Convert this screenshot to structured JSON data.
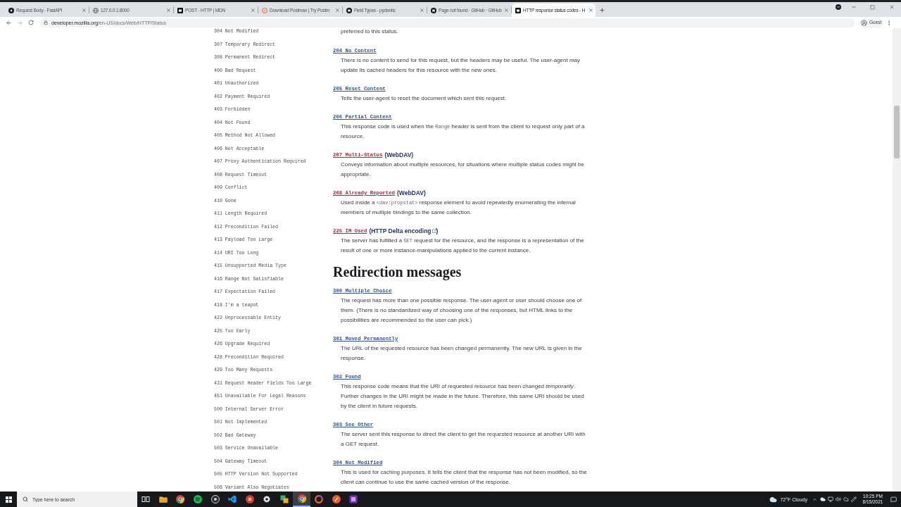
{
  "browser": {
    "tabs": [
      {
        "title": "Request Body - FastAPI",
        "kind": "bolt",
        "selected": false
      },
      {
        "title": "127.0.0.1:8000",
        "kind": "globe",
        "selected": false
      },
      {
        "title": "POST - HTTP | MDN",
        "kind": "square",
        "selected": false
      },
      {
        "title": "Download Postman | Try Postm",
        "kind": "ring",
        "selected": false
      },
      {
        "title": "Field Types - pydantic",
        "kind": "cat",
        "selected": false
      },
      {
        "title": "Page not found · GitHub · GitHub",
        "kind": "cat",
        "selected": false
      },
      {
        "title": "HTTP response status codes - H",
        "kind": "square",
        "selected": true
      }
    ],
    "url": {
      "host": "developer.mozilla.org",
      "path": "/en-US/docs/Web/HTTP/Status"
    },
    "profile": "Guest"
  },
  "sidebar": {
    "items": [
      "304 Not Modified",
      "307 Temporary Redirect",
      "308 Permanent Redirect",
      "400 Bad Request",
      "401 Unauthorized",
      "402 Payment Required",
      "403 Forbidden",
      "404 Not Found",
      "405 Method Not Allowed",
      "406 Not Acceptable",
      "407 Proxy Authentication Required",
      "408 Request Timeout",
      "409 Conflict",
      "410 Gone",
      "411 Length Required",
      "412 Precondition Failed",
      "413 Payload Too Large",
      "414 URI Too Long",
      "415 Unsupported Media Type",
      "416 Range Not Satisfiable",
      "417 Expectation Failed",
      "418 I'm a teapot",
      "422 Unprocessable Entity",
      "425 Too Early",
      "426 Upgrade Required",
      "428 Precondition Required",
      "429 Too Many Requests",
      "431 Request Header Fields Too Large",
      "451 Unavailable For Legal Reasons",
      "500 Internal Server Error",
      "501 Not Implemented",
      "502 Bad Gateway",
      "503 Service Unavailable",
      "504 Gateway Timeout",
      "505 HTTP Version Not Supported",
      "506 Variant Also Negotiates"
    ]
  },
  "content": {
    "lead": "preferred to this status.",
    "blocks": [
      {
        "kind": "entry",
        "term": "204 No Content",
        "color": "#34548c",
        "description": [
          {
            "kind": "text",
            "text": "There is no content to send for this request, but the headers may be useful. The user-agent may update its cached headers for this resource with the new ones."
          }
        ]
      },
      {
        "kind": "entry",
        "term": "205 Reset Content",
        "color": "#34548c",
        "description": [
          {
            "kind": "text",
            "text": "Tells the user-agent to reset the document which sent this request."
          }
        ]
      },
      {
        "kind": "entry",
        "term": "206 Partial Content",
        "color": "#34548c",
        "description": [
          {
            "kind": "text",
            "text": "This response code is used when the "
          },
          {
            "kind": "code",
            "text": "Range"
          },
          {
            "kind": "text",
            "text": " header is sent from the client to request only part of a resource."
          }
        ]
      },
      {
        "kind": "entry",
        "term": "207 Multi-Status",
        "color": "#b02a3e",
        "suffix": {
          "text": "(WebDAV)"
        },
        "description": [
          {
            "kind": "text",
            "text": "Conveys information about multiple resources, for situations where multiple status codes might be appropriate."
          }
        ]
      },
      {
        "kind": "entry",
        "term": "208 Already Reported",
        "color": "#b02a3e",
        "suffix": {
          "text": "(WebDAV)"
        },
        "description": [
          {
            "kind": "text",
            "text": "Used inside a "
          },
          {
            "kind": "code",
            "text": "<dav:propstat>"
          },
          {
            "kind": "text",
            "text": " response element to avoid repeatedly enumerating the internal members of multiple bindings to the same collection."
          }
        ]
      },
      {
        "kind": "entry",
        "term": "226 IM Used",
        "color": "#b02a3e",
        "suffix": {
          "text": "(HTTP Delta encoding",
          "external": true,
          "close": ")"
        },
        "description": [
          {
            "kind": "text",
            "text": "The server has fulfilled a "
          },
          {
            "kind": "code",
            "text": "GET"
          },
          {
            "kind": "text",
            "text": " request for the resource, and the response is a representation of the result of one or more instance-manipulations applied to the current instance."
          }
        ]
      },
      {
        "kind": "heading",
        "text": "Redirection messages"
      },
      {
        "kind": "entry",
        "term": "300 Multiple Choice",
        "color": "#34548c",
        "description": [
          {
            "kind": "text",
            "text": "The request has more than one possible response. The user-agent or user should choose one of them. (There is no standardized way of choosing one of the responses, but HTML links to the possibilities are recommended so the user can pick.)"
          }
        ]
      },
      {
        "kind": "entry",
        "term": "301 Moved Permanently",
        "color": "#34548c",
        "description": [
          {
            "kind": "text",
            "text": "The URL of the requested resource has been changed permanently. The new URL is given in the response."
          }
        ]
      },
      {
        "kind": "entry",
        "term": "302 Found",
        "color": "#34548c",
        "description": [
          {
            "kind": "text",
            "text": "This response code means that the URI of requested resource has been changed *temporarily*. Further changes in the URI might be made in the future. Therefore, this same URI should be used by the client in future requests."
          }
        ]
      },
      {
        "kind": "entry",
        "term": "303 See Other",
        "color": "#34548c",
        "description": [
          {
            "kind": "text",
            "text": "The server sent this response to direct the client to get the requested resource at another URI with a GET request."
          }
        ]
      },
      {
        "kind": "entry",
        "term": "304 Not Modified",
        "color": "#34548c",
        "description": [
          {
            "kind": "text",
            "text": "This is used for caching purposes. It tells the client that the response has not been modified, so the client can continue to use the same cached version of the response."
          }
        ]
      }
    ]
  },
  "taskbar": {
    "search": {
      "placeholder": "Type here to search"
    },
    "apps": [
      {
        "kind": "task_view",
        "selected": false
      },
      {
        "kind": "folder",
        "selected": false
      },
      {
        "kind": "browser",
        "selected": false
      },
      {
        "kind": "music",
        "selected": false
      },
      {
        "kind": "circle",
        "selected": false
      },
      {
        "kind": "code",
        "selected": false
      },
      {
        "kind": "red",
        "selected": false
      },
      {
        "kind": "settings",
        "selected": false
      },
      {
        "kind": "tiles",
        "selected": false
      },
      {
        "kind": "browser",
        "selected": true
      },
      {
        "kind": "ring",
        "selected": false
      },
      {
        "kind": "slash",
        "selected": false
      },
      {
        "kind": "note",
        "selected": false
      }
    ],
    "weather": "72°F Cloudy",
    "time": "10:25 PM",
    "date": "8/15/2021"
  }
}
